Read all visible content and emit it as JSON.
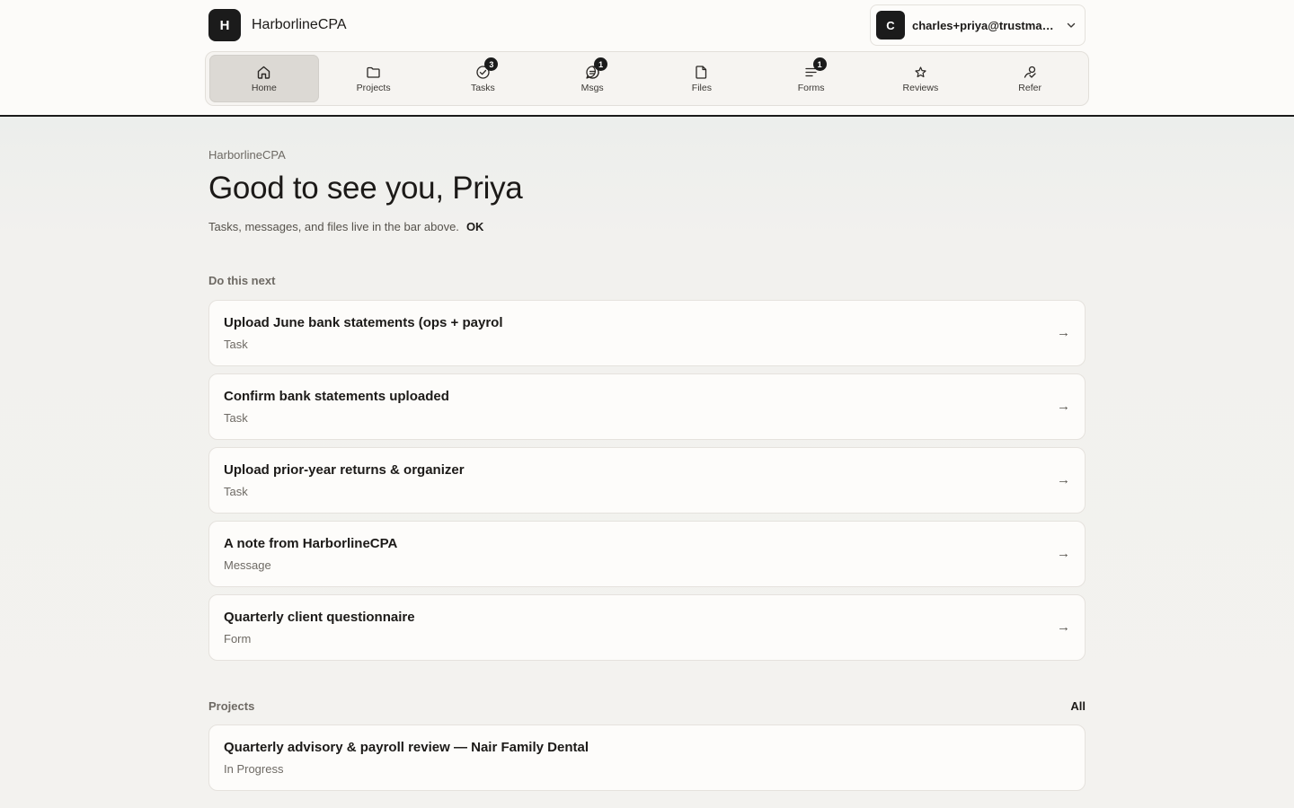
{
  "header": {
    "brand_initial": "H",
    "brand_name": "HarborlineCPA",
    "account": {
      "avatar_initial": "C",
      "email": "charles+priya@trustmarket..."
    }
  },
  "nav": {
    "items": [
      {
        "label": "Home",
        "icon": "home-icon",
        "badge": ""
      },
      {
        "label": "Projects",
        "icon": "folder-icon",
        "badge": ""
      },
      {
        "label": "Tasks",
        "icon": "check-circle-icon",
        "badge": "3"
      },
      {
        "label": "Msgs",
        "icon": "message-icon",
        "badge": "1"
      },
      {
        "label": "Files",
        "icon": "file-icon",
        "badge": ""
      },
      {
        "label": "Forms",
        "icon": "list-icon",
        "badge": "1"
      },
      {
        "label": "Reviews",
        "icon": "star-icon",
        "badge": ""
      },
      {
        "label": "Refer",
        "icon": "refer-icon",
        "badge": ""
      }
    ],
    "active": "Home"
  },
  "main": {
    "eyebrow": "HarborlineCPA",
    "greeting": "Good to see you, Priya",
    "hint": "Tasks, messages, and files live in the bar above.",
    "hint_ok": "OK",
    "next": {
      "title": "Do this next",
      "items": [
        {
          "title": "Upload June bank statements (ops + payrol",
          "type": "Task"
        },
        {
          "title": "Confirm bank statements uploaded",
          "type": "Task"
        },
        {
          "title": "Upload prior-year returns & organizer",
          "type": "Task"
        },
        {
          "title": "A note from HarborlineCPA",
          "type": "Message"
        },
        {
          "title": "Quarterly client questionnaire",
          "type": "Form"
        }
      ],
      "arrow": "→"
    },
    "projects": {
      "title": "Projects",
      "all_label": "All",
      "items": [
        {
          "title": "Quarterly advisory & payroll review — Nair Family Dental",
          "status": "In Progress"
        }
      ]
    }
  }
}
